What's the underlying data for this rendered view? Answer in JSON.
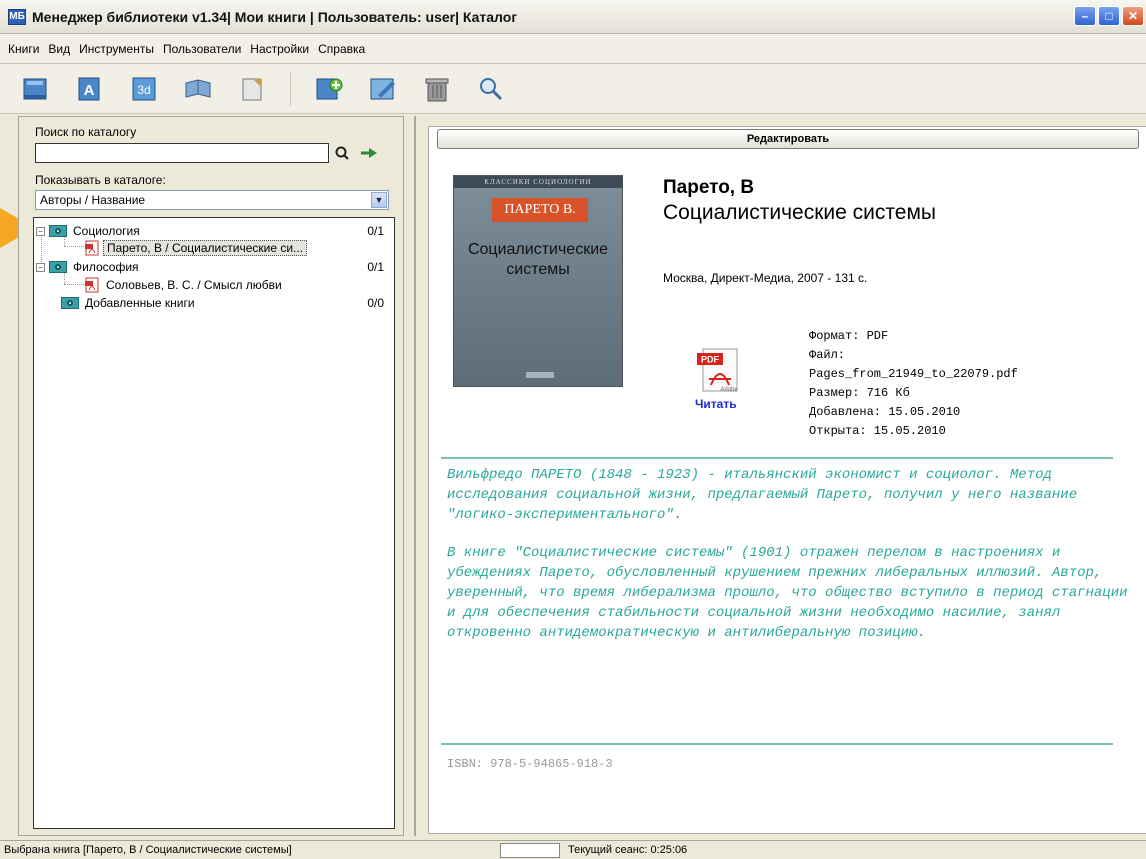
{
  "window": {
    "title": "Менеджер библиотеки v1.34| Мои книги | Пользователь: user| Каталог",
    "app_icon_text": "МБ"
  },
  "menu": [
    "Книги",
    "Вид",
    "Инструменты",
    "Пользователи",
    "Настройки",
    "Справка"
  ],
  "toolbar": {
    "icons": [
      "book-icon",
      "author-icon",
      "3d-view-icon",
      "open-book-icon",
      "note-icon",
      "add-book-icon",
      "edit-book-icon",
      "delete-book-icon",
      "search-icon"
    ]
  },
  "left": {
    "search_label": "Поиск по каталогу",
    "search_value": "",
    "show_label": "Показывать в каталоге:",
    "show_selected": "Авторы / Название",
    "tree": [
      {
        "label": "Социология",
        "count": "0/1",
        "children": [
          {
            "label": "Парето, В / Социалистические си..."
          }
        ]
      },
      {
        "label": "Философия",
        "count": "0/1",
        "children": [
          {
            "label": "Соловьев, В. С. / Смысл любви"
          }
        ]
      },
      {
        "label": "Добавленные книги",
        "count": "0/0",
        "children": []
      }
    ]
  },
  "right": {
    "edit_label": "Редактировать",
    "cover": {
      "series": "КЛАССИКИ СОЦИОЛОГИИ",
      "author": "ПАРЕТО В.",
      "title_line1": "Социалистические",
      "title_line2": "системы"
    },
    "author": "Парето, В",
    "title": "Социалистические системы",
    "publication": "Москва, Директ-Медиа, 2007 - 131 с.",
    "read_label": "Читать",
    "meta": {
      "format": "Формат: PDF",
      "file_label": "Файл:",
      "file_name": "Pages_from_21949_to_22079.pdf",
      "size": "Размер: 716 Кб",
      "added": "Добавлена: 15.05.2010",
      "opened": "Открыта: 15.05.2010"
    },
    "description": [
      "Вильфредо ПАРЕТО (1848 - 1923) - итальянский экономист и социолог. Метод исследования социальной жизни, предлагаемый Парето, получил у него название \"логико-экспериментального\".",
      "В книге \"Социалистические системы\" (1901) отражен перелом в настроениях и убеждениях Парето, обусловленный крушением прежних либеральных иллюзий. Автор, уверенный, что время либерализма прошло, что общество вступило в период стагнации и для обеспечения стабильности социальной жизни необходимо насилие, занял откровенно антидемократическую и антилиберальную позицию."
    ],
    "isbn": "ISBN: 978-5-94865-918-3"
  },
  "status": {
    "selected": "Выбрана книга [Парето, В / Социалистические системы]",
    "session": "Текущий сеанс: 0:25:06"
  }
}
